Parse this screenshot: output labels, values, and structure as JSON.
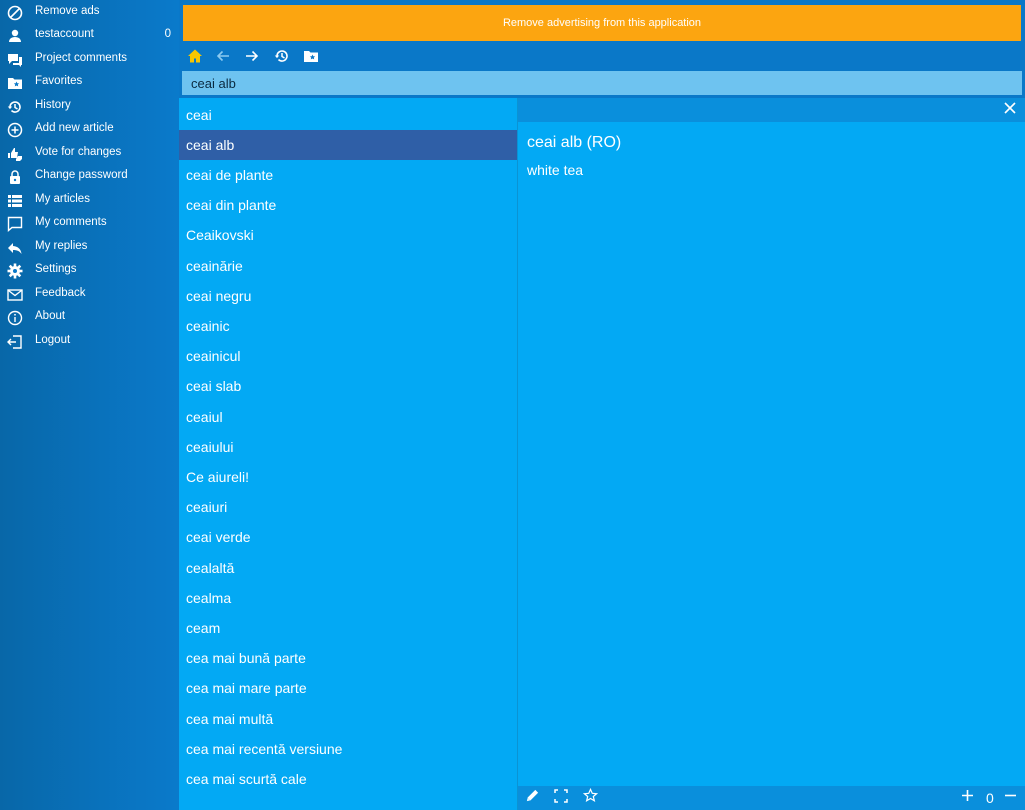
{
  "sidebar": {
    "items": [
      {
        "label": "Remove ads",
        "icon": "block-icon"
      },
      {
        "label": "testaccount",
        "icon": "user-icon",
        "count": "0"
      },
      {
        "label": "Project comments",
        "icon": "chat-icon"
      },
      {
        "label": "Favorites",
        "icon": "favorites-folder-icon"
      },
      {
        "label": "History",
        "icon": "history-icon"
      },
      {
        "label": "Add new article",
        "icon": "add-circle-icon"
      },
      {
        "label": "Vote for changes",
        "icon": "thumbs-icon"
      },
      {
        "label": "Change password",
        "icon": "lock-icon"
      },
      {
        "label": "My articles",
        "icon": "list-icon"
      },
      {
        "label": "My comments",
        "icon": "comment-icon"
      },
      {
        "label": "My replies",
        "icon": "reply-icon"
      },
      {
        "label": "Settings",
        "icon": "gear-icon"
      },
      {
        "label": "Feedback",
        "icon": "mail-icon"
      },
      {
        "label": "About",
        "icon": "info-icon"
      },
      {
        "label": "Logout",
        "icon": "logout-icon"
      }
    ]
  },
  "ad_banner": {
    "text": "Remove advertising from this application"
  },
  "toolbar": {
    "icons": [
      "home-icon",
      "back-icon",
      "forward-icon",
      "history-icon",
      "favorites-folder-icon"
    ]
  },
  "search": {
    "value": "ceai alb"
  },
  "word_list": {
    "selected_index": 1,
    "items": [
      "ceai",
      "ceai alb",
      "ceai de plante",
      "ceai din plante",
      "Ceaikovski",
      "ceainărie",
      "ceai negru",
      "ceainic",
      "ceainicul",
      "ceai slab",
      "ceaiul",
      "ceaiului",
      "Ce aiureli!",
      "ceaiuri",
      "ceai verde",
      "cealaltă",
      "cealma",
      "ceam",
      "cea mai bună parte",
      "cea mai mare parte",
      "cea mai multă",
      "cea mai recentă versiune",
      "cea mai scurtă cale"
    ]
  },
  "detail": {
    "title": "ceai alb (RO)",
    "translation": "white tea",
    "zoom": "0"
  },
  "colors": {
    "accent": "#03a9f4",
    "sidebar": "#0a78c8",
    "selected": "#2f5fa7",
    "banner": "#fca510",
    "home_icon": "#f7c600"
  }
}
